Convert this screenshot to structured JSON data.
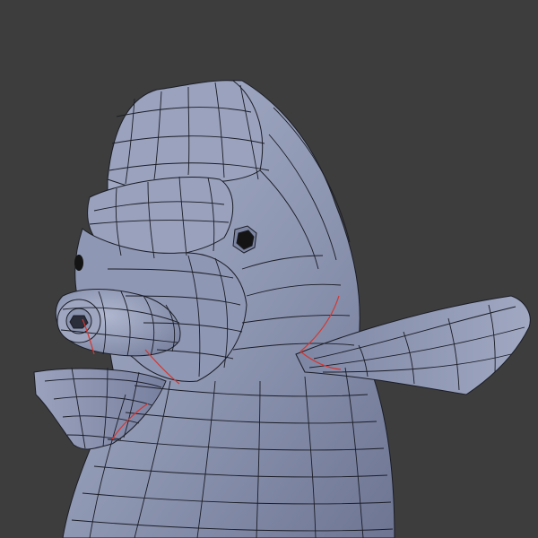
{
  "viewport": {
    "background": "#3d3d3d",
    "mesh_fill": "#8c95b0",
    "mesh_fill_light": "#a3abc5",
    "mesh_fill_dark": "#5f6784",
    "wire_color": "#1b1d26",
    "seam_color": "#d8352f",
    "eye_color": "#141414"
  }
}
